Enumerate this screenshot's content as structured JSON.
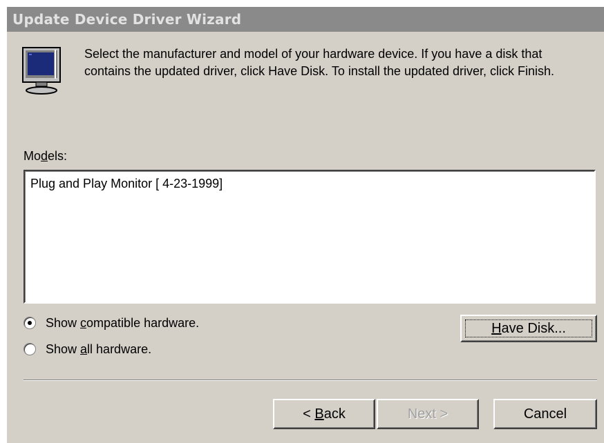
{
  "window": {
    "title": "Update Device Driver Wizard"
  },
  "icon": {
    "name": "monitor-icon"
  },
  "instructions": "Select the manufacturer and model of your hardware device. If you have a disk that contains the updated driver, click Have Disk. To install the updated driver, click Finish.",
  "models": {
    "label": "Models:",
    "items": [
      "Plug and Play Monitor [ 4-23-1999]"
    ]
  },
  "options": {
    "compatible": {
      "label": "Show compatible hardware.",
      "selected": true
    },
    "all": {
      "label": "Show all hardware.",
      "selected": false
    }
  },
  "buttons": {
    "have_disk": "Have Disk...",
    "back": "< Back",
    "next": "Next >",
    "cancel": "Cancel"
  },
  "colors": {
    "face": "#d4d0c8",
    "titlebar": "#8a8a8a",
    "monitor_screen": "#1c2a7a"
  }
}
